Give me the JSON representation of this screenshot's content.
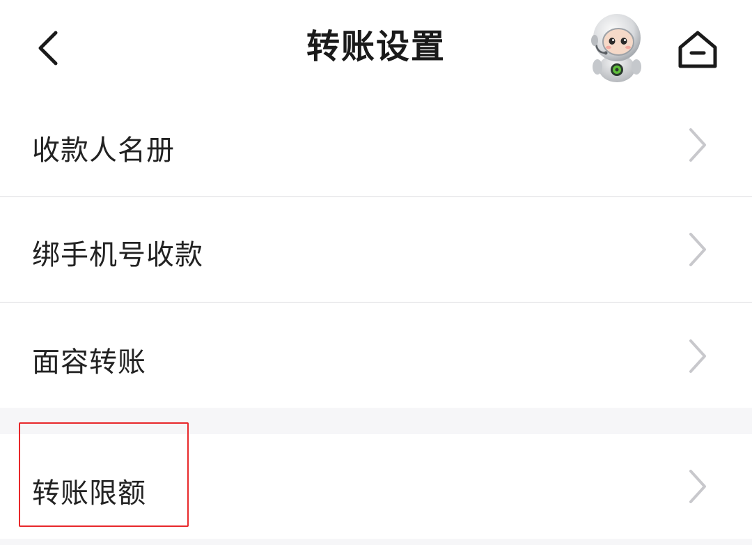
{
  "header": {
    "title": "转账设置",
    "back_icon": "chevron-left-icon",
    "assistant_icon": "robot-mascot-icon",
    "home_icon": "home-icon"
  },
  "menu": {
    "items": [
      {
        "label": "收款人名册",
        "icon": "chevron-right-icon"
      },
      {
        "label": "绑手机号收款",
        "icon": "chevron-right-icon"
      },
      {
        "label": "面容转账",
        "icon": "chevron-right-icon"
      },
      {
        "label": "转账限额",
        "icon": "chevron-right-icon",
        "highlighted": true
      }
    ]
  },
  "colors": {
    "highlight_border": "#e8282b",
    "chevron": "#c8c8cc",
    "title_text": "#1a1a1a",
    "separator_band": "#f6f6f8"
  }
}
